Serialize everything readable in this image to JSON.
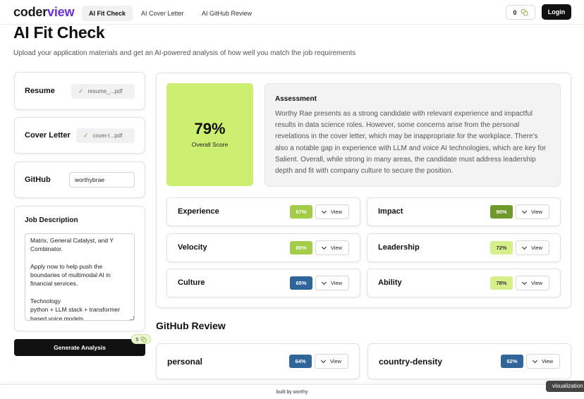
{
  "nav": {
    "logo_part1": "coder",
    "logo_part2": "view",
    "tabs": [
      {
        "label": "AI Fit Check",
        "active": true
      },
      {
        "label": "AI Cover Letter",
        "active": false
      },
      {
        "label": "AI GitHub Review",
        "active": false
      }
    ],
    "credits": "0",
    "credits_icon": "coins-icon",
    "login_label": "Login"
  },
  "header": {
    "title": "AI Fit Check",
    "subtitle": "Upload your application materials and get an AI-powered analysis of how well you match the job requirements"
  },
  "sidebar": {
    "resume": {
      "label": "Resume",
      "file": "resume_...pdf",
      "status_icon": "check-icon"
    },
    "cover_letter": {
      "label": "Cover Letter",
      "file": "cover-l...pdf",
      "status_icon": "check-icon"
    },
    "github": {
      "label": "GitHub",
      "value": "worthybrae"
    },
    "job_description": {
      "label": "Job Description",
      "text": "Matrix, General Catalyst, and Y\nCombinator.\n\nApply now to help push the\nboundaries of multimodal AI in\nfinancial services.\n\nTechnology\npython + LLM stack + transformer\nbased voice models"
    },
    "generate_label": "Generate Analysis",
    "generate_cost": "5"
  },
  "results": {
    "overall_score": "79%",
    "overall_label": "Overall Score",
    "assessment_title": "Assessment",
    "assessment_text": "Worthy Rae presents as a strong candidate with relevant experience and impactful results in data science roles. However, some concerns arise from the personal revelations in the cover letter, which may be inappropriate for the workplace. There's also a notable gap in experience with LLM and voice AI technologies, which are key for Salient. Overall, while strong in many areas, the candidate must address leadership depth and fit with company culture to secure the position.",
    "view_label": "View",
    "metrics": [
      {
        "name": "Experience",
        "score": "87%",
        "bg": "#a3cc48",
        "fg": "#ffffff"
      },
      {
        "name": "Impact",
        "score": "90%",
        "bg": "#6f9a2b",
        "fg": "#ffffff"
      },
      {
        "name": "Velocity",
        "score": "80%",
        "bg": "#a3cc48",
        "fg": "#ffffff"
      },
      {
        "name": "Leadership",
        "score": "72%",
        "bg": "#d6ef8a",
        "fg": "#333333"
      },
      {
        "name": "Culture",
        "score": "65%",
        "bg": "#30659a",
        "fg": "#ffffff"
      },
      {
        "name": "Ability",
        "score": "78%",
        "bg": "#d6ef8a",
        "fg": "#333333"
      }
    ]
  },
  "github_review": {
    "title": "GitHub Review",
    "repos": [
      {
        "name": "personal",
        "score": "64%",
        "bg": "#30659a",
        "fg": "#ffffff"
      },
      {
        "name": "country-density",
        "score": "62%",
        "bg": "#30659a",
        "fg": "#ffffff"
      }
    ]
  },
  "footer": {
    "text": "built by worthy",
    "tag": "visualization"
  },
  "colors": {
    "accent": "#6b2fd6",
    "score_tile": "#ccee71",
    "button_dark": "#111111"
  }
}
